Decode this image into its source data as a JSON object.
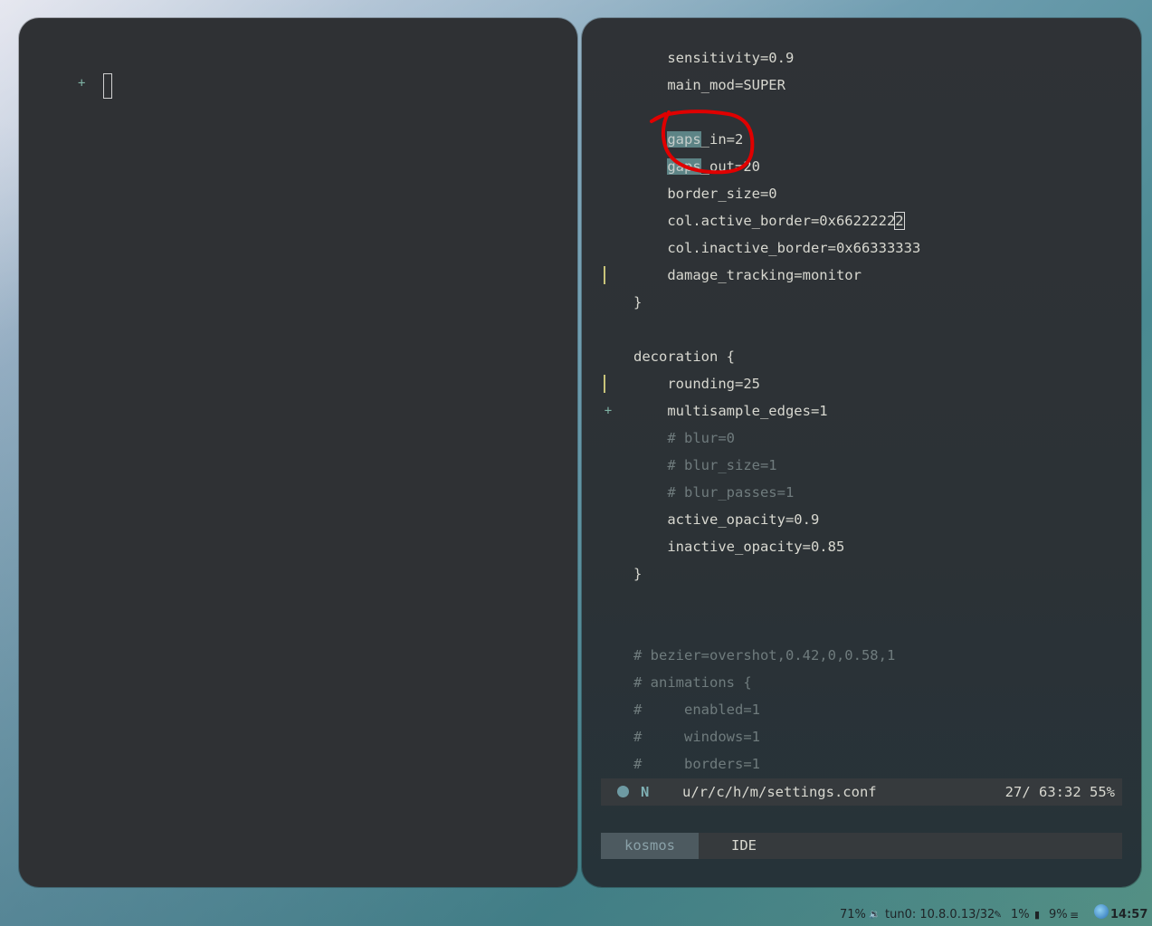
{
  "left_terminal": {
    "prompt_symbol": "+"
  },
  "editor": {
    "lines": [
      {
        "gutter": "",
        "text": "    sensitivity=0.9",
        "kind": "code"
      },
      {
        "gutter": "",
        "text": "    main_mod=SUPER",
        "kind": "code"
      },
      {
        "gutter": "",
        "text": "",
        "kind": "code"
      },
      {
        "gutter": "",
        "pre": "    ",
        "hl": "gaps",
        "text": "_in=2",
        "kind": "hl"
      },
      {
        "gutter": "",
        "pre": "    ",
        "hl": "gaps",
        "text": "_out=20",
        "kind": "hl"
      },
      {
        "gutter": "",
        "text": "    border_size=0",
        "kind": "code"
      },
      {
        "gutter": "",
        "text": "    col.active_border=0x6622222",
        "cursor": "2",
        "kind": "cursor"
      },
      {
        "gutter": "",
        "text": "    col.inactive_border=0x66333333",
        "kind": "code"
      },
      {
        "gutter": "bar",
        "text": "    damage_tracking=monitor",
        "kind": "code"
      },
      {
        "gutter": "",
        "text": "}",
        "kind": "code"
      },
      {
        "gutter": "",
        "text": "",
        "kind": "code"
      },
      {
        "gutter": "",
        "text": "decoration {",
        "kind": "code"
      },
      {
        "gutter": "bar",
        "text": "    rounding=25",
        "kind": "code"
      },
      {
        "gutter": "add",
        "text": "    multisample_edges=1",
        "kind": "code"
      },
      {
        "gutter": "",
        "text": "    # blur=0",
        "kind": "comment"
      },
      {
        "gutter": "",
        "text": "    # blur_size=1",
        "kind": "comment"
      },
      {
        "gutter": "",
        "text": "    # blur_passes=1",
        "kind": "comment"
      },
      {
        "gutter": "",
        "text": "    active_opacity=0.9",
        "kind": "code"
      },
      {
        "gutter": "",
        "text": "    inactive_opacity=0.85",
        "kind": "code"
      },
      {
        "gutter": "",
        "text": "}",
        "kind": "code"
      },
      {
        "gutter": "",
        "text": "",
        "kind": "code"
      },
      {
        "gutter": "",
        "text": "",
        "kind": "code"
      },
      {
        "gutter": "",
        "text": "# bezier=overshot,0.42,0,0.58,1",
        "kind": "comment"
      },
      {
        "gutter": "",
        "text": "# animations {",
        "kind": "comment"
      },
      {
        "gutter": "",
        "text": "#     enabled=1",
        "kind": "comment"
      },
      {
        "gutter": "",
        "text": "#     windows=1",
        "kind": "comment"
      },
      {
        "gutter": "",
        "text": "#     borders=1",
        "kind": "comment"
      }
    ],
    "gutter_add_symbol": "+",
    "statusline": {
      "mode": "N",
      "file": "u/r/c/h/m/settings.conf",
      "position": "27/ 63:32 55%"
    },
    "tabs": [
      {
        "label": "kosmos",
        "active": true
      },
      {
        "label": "IDE",
        "active": false
      }
    ]
  },
  "panel": {
    "volume": "71%",
    "volume_icon": "speaker-icon",
    "network": "tun0: 10.8.0.13/32",
    "network_icon": "link-icon",
    "cpu": "1%",
    "memory": "9%",
    "clock": "14:57"
  },
  "colors": {
    "window_bg": "#2f3134",
    "highlight": "#5d8486",
    "annotation": "#e00000"
  }
}
